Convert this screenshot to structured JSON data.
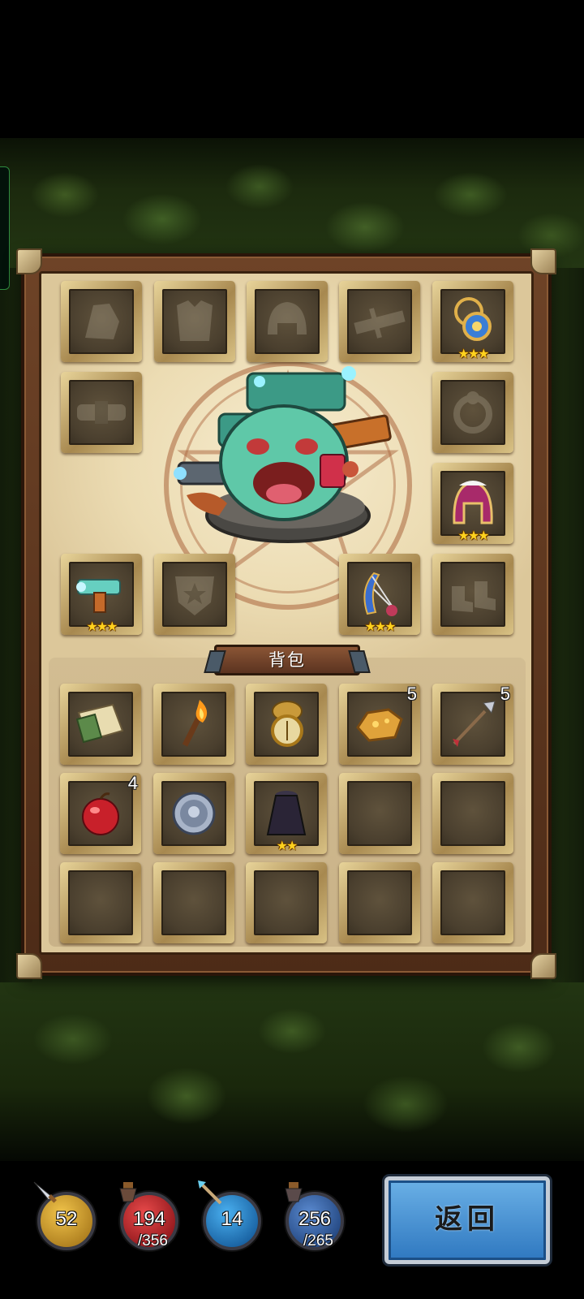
{
  "equipment": {
    "slots": [
      {
        "id": "weapon-empty",
        "empty": true
      },
      {
        "id": "armor-empty",
        "empty": true
      },
      {
        "id": "helmet-empty",
        "empty": true
      },
      {
        "id": "crossbow-empty",
        "empty": true
      },
      {
        "id": "amulet",
        "stars": "★★★"
      },
      {
        "id": "belt-empty",
        "empty": true
      },
      {
        "id": "ring-empty",
        "empty": true
      },
      {
        "id": "helm",
        "stars": "★★★"
      },
      {
        "id": "mech-weapon",
        "stars": "★★★"
      },
      {
        "id": "shield-empty",
        "empty": true
      },
      {
        "id": "lyre-bow",
        "stars": "★★★"
      },
      {
        "id": "boots-empty",
        "empty": true
      }
    ]
  },
  "bag": {
    "title": "背包",
    "items": [
      {
        "name": "map-scroll"
      },
      {
        "name": "torch"
      },
      {
        "name": "compass"
      },
      {
        "name": "ore",
        "count": "5"
      },
      {
        "name": "arrow",
        "count": "5"
      },
      {
        "name": "apple",
        "count": "4"
      },
      {
        "name": "silver-coin"
      },
      {
        "name": "cloak",
        "stars": "★★"
      }
    ]
  },
  "stats": {
    "attack": {
      "value": "52",
      "color": "#c8951e"
    },
    "health": {
      "value": "194",
      "max": "/356",
      "color": "#b51c24"
    },
    "mana": {
      "value": "14",
      "color": "#1e7fc8"
    },
    "armor": {
      "value": "256",
      "max": "/265",
      "color": "#2b5c9e"
    }
  },
  "back_button": {
    "label": "返回"
  }
}
